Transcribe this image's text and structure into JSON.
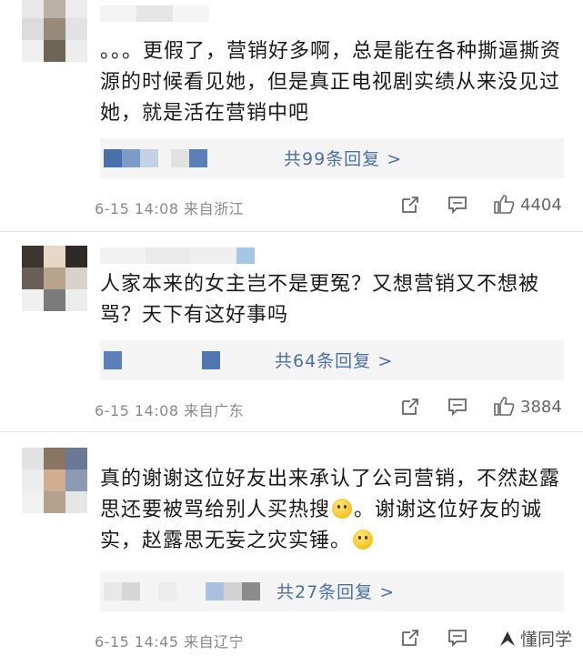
{
  "comments": [
    {
      "text": "。。。更假了，营销好多啊，总是能在各种撕逼撕资源的时候看见她，但是真正电视剧实绩从来没见过她，就是活在营销中吧",
      "reply_label": "共99条回复 >",
      "meta": "6-15 14:08 来自浙江",
      "likes": "4404"
    },
    {
      "text": "人家本来的女主岂不是更冤？又想营销又不想被骂？天下有这好事吗",
      "reply_label": "共64条回复 >",
      "meta": "6-15 14:08 来自广东",
      "likes": "3884"
    },
    {
      "text_part1": "真的谢谢这位好友出来承认了公司营销，不然赵露思还要被骂给别人买热搜",
      "text_part2": "。谢谢这位好友的诚实，赵露思无妄之灾实锤。",
      "reply_label": "共27条回复 >",
      "meta": "6-15 14:45 来自辽宁"
    }
  ],
  "watermark": "懂同学",
  "icons": {
    "share": "share-icon",
    "comment": "comment-icon",
    "like": "thumbs-up-icon",
    "emoji": "smile-emoji-icon"
  },
  "colors": {
    "link": "#4a6fa5",
    "meta": "#888888",
    "reply_bg": "#f4f4f4"
  }
}
